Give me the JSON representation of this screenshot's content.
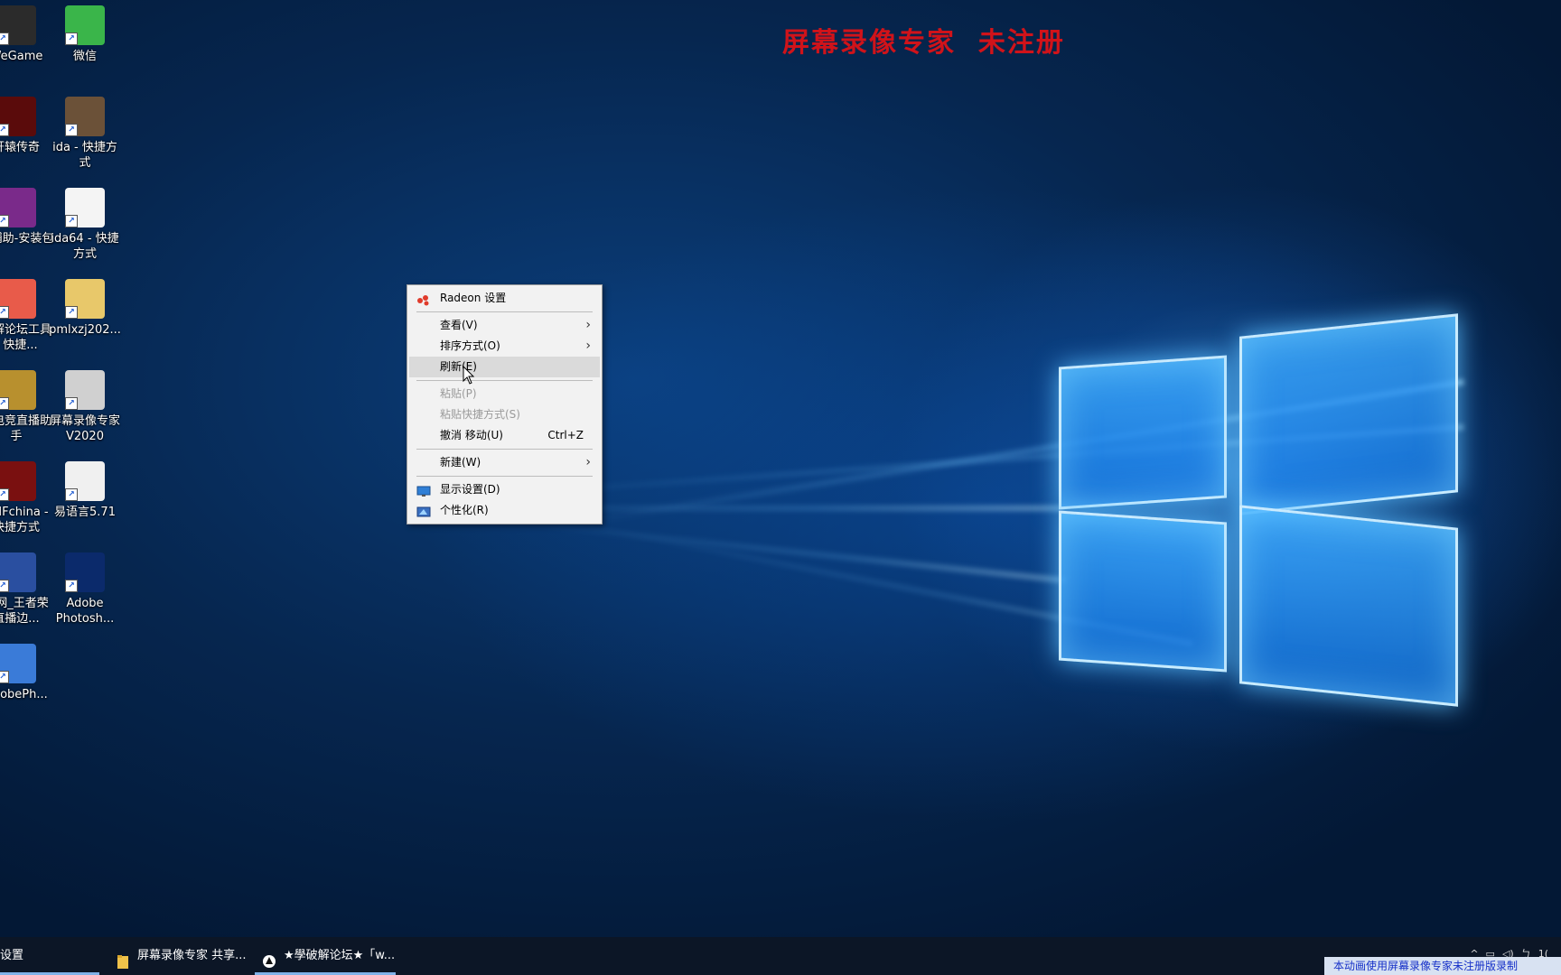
{
  "watermark": {
    "text": "屏幕录像专家  未注册",
    "color": "#d0131a"
  },
  "desktop_icons": [
    {
      "label": "WeGame",
      "icon": "wegame-icon",
      "color": "#2b2b2b"
    },
    {
      "label": "微信",
      "icon": "wechat-icon",
      "color": "#3ab54a"
    },
    {
      "label": "轩辕传奇",
      "icon": "game-icon",
      "color": "#5a0b0b"
    },
    {
      "label": "ida - 快捷方式",
      "icon": "ida-icon",
      "color": "#6b5138"
    },
    {
      "label": "电辅助-安装包",
      "icon": "winrar-icon",
      "color": "#7a2a8a"
    },
    {
      "label": "ida64 - 快捷方式",
      "icon": "file-icon",
      "color": "#f4f4f4"
    },
    {
      "label": "破解论坛工具 - 快捷...",
      "icon": "toolkit-icon",
      "color": "#e85b4a"
    },
    {
      "label": "pmlxzj202...",
      "icon": "folder-icon",
      "color": "#e8c86a"
    },
    {
      "label": "德电竞直播助手",
      "icon": "esports-icon",
      "color": "#b8902e"
    },
    {
      "label": "屏幕录像专家V2020",
      "icon": "recorder-icon",
      "color": "#d0d0d0"
    },
    {
      "label": "DNFchina - 快捷方式",
      "icon": "dnf-icon",
      "color": "#7a1010"
    },
    {
      "label": "易语言5.71",
      "icon": "eyuyan-icon",
      "color": "#f0f0f0"
    },
    {
      "label": "图网_王者荣直播边...",
      "icon": "document-icon",
      "color": "#2a4fa0"
    },
    {
      "label": "Adobe Photosh...",
      "icon": "photoshop-icon",
      "color": "#0b2a6b"
    },
    {
      "label": "AdobePh...",
      "icon": "adobe-folder-icon",
      "color": "#3a7bd8"
    }
  ],
  "context_menu": {
    "items": [
      {
        "type": "item",
        "label": "Radeon 设置",
        "icon": "radeon-icon"
      },
      {
        "type": "sep"
      },
      {
        "type": "item",
        "label": "查看(V)",
        "submenu": true
      },
      {
        "type": "item",
        "label": "排序方式(O)",
        "submenu": true
      },
      {
        "type": "item",
        "label": "刷新(E)",
        "hover": true
      },
      {
        "type": "sep"
      },
      {
        "type": "item",
        "label": "粘贴(P)",
        "disabled": true
      },
      {
        "type": "item",
        "label": "粘贴快捷方式(S)",
        "disabled": true
      },
      {
        "type": "item",
        "label": "撤消 移动(U)",
        "shortcut": "Ctrl+Z"
      },
      {
        "type": "sep"
      },
      {
        "type": "item",
        "label": "新建(W)",
        "submenu": true
      },
      {
        "type": "sep"
      },
      {
        "type": "item",
        "label": "显示设置(D)",
        "icon": "display-icon"
      },
      {
        "type": "item",
        "label": "个性化(R)",
        "icon": "personalize-icon"
      }
    ]
  },
  "taskbar": {
    "items": [
      {
        "label": "设置",
        "icon": "settings-icon",
        "active": true
      },
      {
        "label": "屏幕录像专家 共享...",
        "icon": "folder-icon",
        "active": false
      },
      {
        "label": "★學破解论坛★「w...",
        "icon": "browser-icon",
        "active": true
      }
    ],
    "clock_fragment": "1(",
    "recording_notice": "本动画使用屏幕录像专家未注册版录制"
  }
}
